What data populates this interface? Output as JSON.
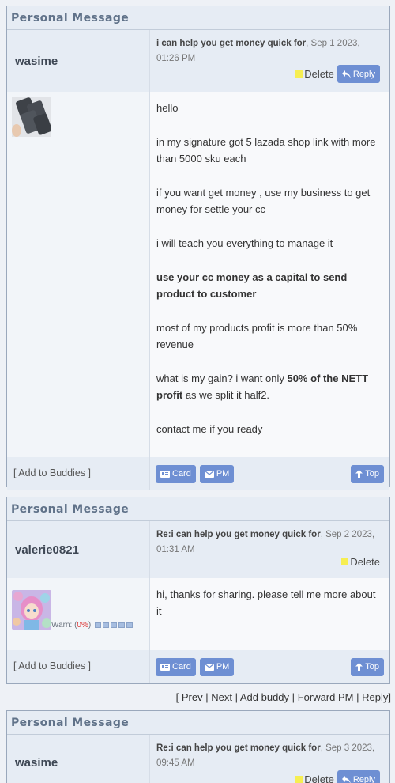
{
  "panel_title": "Personal Message",
  "labels": {
    "delete": "Delete",
    "reply": "Reply",
    "card": "Card",
    "pm": "PM",
    "top": "Top",
    "add_buddies": "[ Add to Buddies ]"
  },
  "messages": [
    {
      "username": "wasime",
      "subject": "i can help you get money quick for",
      "date": ", Sep 1 2023, 01:26 PM",
      "body": [
        {
          "text": "hello"
        },
        {
          "text": "in my signature got 5 lazada shop link with more than 5000 sku each"
        },
        {
          "text": "if you want get money , use my business to get money for settle your cc"
        },
        {
          "text": "i will teach you everything to manage it"
        },
        {
          "bold": "use your cc money as a capital to send product to customer"
        },
        {
          "text": "most of my products profit is more than 50% revenue"
        },
        {
          "pre": "what is my gain? i want only ",
          "bold": "50% of the NETT profit",
          "post": " as we split it half2."
        },
        {
          "text": "contact me if you ready"
        }
      ]
    },
    {
      "username": "valerie0821",
      "subject": "Re:i can help you get money quick for",
      "date": ", Sep 2 2023, 01:31 AM",
      "warn_label": "Warn: (",
      "warn_pct": "0%",
      "warn_close": ")",
      "body": [
        {
          "text": "hi, thanks for sharing. please tell me more about it"
        }
      ]
    },
    {
      "username": "wasime",
      "subject": "Re:i can help you get money quick for",
      "date": ", Sep 3 2023, 09:45 AM"
    }
  ],
  "pm_nav": {
    "open": "[",
    "prev": "Prev",
    "next": "Next",
    "add_buddy": "Add buddy",
    "forward": "Forward PM",
    "reply": "Reply",
    "close": "]",
    "sep": "|"
  },
  "colors": {
    "button": "#6e8fd3",
    "header_bg": "#e6ecf4",
    "title_text": "#607289",
    "delete_marker": "#f6ee52",
    "warn_pct": "#dd3333"
  }
}
